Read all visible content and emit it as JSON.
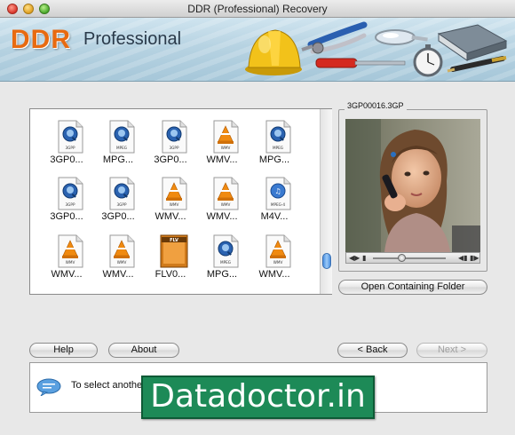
{
  "window": {
    "title": "DDR (Professional) Recovery"
  },
  "banner": {
    "logo_ddr": "DDR",
    "logo_professional": "Professional"
  },
  "files": [
    {
      "label": "3GP0...",
      "icon_text": "3GPP",
      "icon": "quicktime-file-icon"
    },
    {
      "label": "MPG...",
      "icon_text": "MPEG",
      "icon": "quicktime-file-icon"
    },
    {
      "label": "3GP0...",
      "icon_text": "3GPP",
      "icon": "quicktime-file-icon"
    },
    {
      "label": "WMV...",
      "icon_text": "WMV",
      "icon": "vlc-cone-file-icon"
    },
    {
      "label": "MPG...",
      "icon_text": "MPEG",
      "icon": "quicktime-file-icon"
    },
    {
      "label": "3GP0...",
      "icon_text": "3GPP",
      "icon": "quicktime-file-icon"
    },
    {
      "label": "3GP0...",
      "icon_text": "3GPP",
      "icon": "quicktime-file-icon"
    },
    {
      "label": "WMV...",
      "icon_text": "WMV",
      "icon": "vlc-cone-file-icon"
    },
    {
      "label": "WMV...",
      "icon_text": "WMV",
      "icon": "vlc-cone-file-icon"
    },
    {
      "label": "M4V...",
      "icon_text": "MPEG-4",
      "icon": "m4v-file-icon"
    },
    {
      "label": "WMV...",
      "icon_text": "WMV",
      "icon": "vlc-cone-file-icon"
    },
    {
      "label": "WMV...",
      "icon_text": "WMV",
      "icon": "vlc-cone-file-icon"
    },
    {
      "label": "FLV0...",
      "icon_text": "FLV",
      "icon": "flv-file-icon"
    },
    {
      "label": "MPG...",
      "icon_text": "MPEG",
      "icon": "quicktime-file-icon"
    },
    {
      "label": "WMV...",
      "icon_text": "WMV",
      "icon": "vlc-cone-file-icon"
    }
  ],
  "preview": {
    "title": "3GP00016.3GP",
    "open_folder_label": "Open Containing Folder"
  },
  "buttons": {
    "help": "Help",
    "about": "About",
    "back": "< Back",
    "next": "Next >"
  },
  "status": {
    "message": "To select anothe"
  },
  "watermark": {
    "text": "Datadoctor.in"
  },
  "colors": {
    "logo_orange": "#e86a10",
    "watermark_green": "#1d8a57",
    "scroll_blue": "#4a8fe0"
  }
}
